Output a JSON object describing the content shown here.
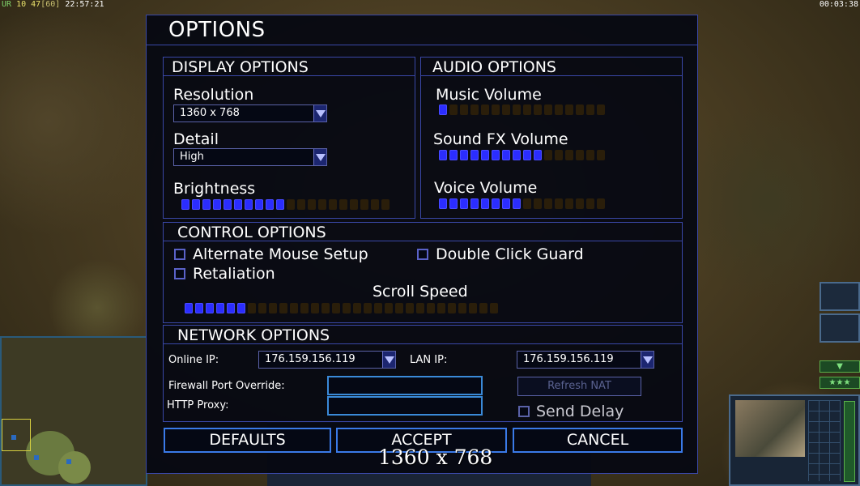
{
  "hud": {
    "rank": "UR",
    "stat_a": "10",
    "stat_b": "47",
    "fps": "[60]",
    "clock": "22:57:21",
    "game_time": "00:03:38"
  },
  "dialog": {
    "title": "OPTIONS",
    "display": {
      "header": "DISPLAY OPTIONS",
      "resolution_label": "Resolution",
      "resolution_value": "1360 x 768",
      "detail_label": "Detail",
      "detail_value": "High",
      "brightness_label": "Brightness",
      "brightness_level": 0.5
    },
    "audio": {
      "header": "AUDIO OPTIONS",
      "music_label": "Music Volume",
      "music_level": 0.0625,
      "sfx_label": "Sound FX Volume",
      "sfx_level": 0.625,
      "voice_label": "Voice Volume",
      "voice_level": 0.5
    },
    "control": {
      "header": "CONTROL OPTIONS",
      "alt_mouse_label": "Alternate Mouse Setup",
      "alt_mouse_checked": false,
      "double_click_label": "Double Click Guard",
      "double_click_checked": false,
      "retaliation_label": "Retaliation",
      "retaliation_checked": false,
      "scroll_label": "Scroll Speed",
      "scroll_level": 0.2
    },
    "network": {
      "header": "NETWORK OPTIONS",
      "online_ip_label": "Online IP:",
      "online_ip_value": "176.159.156.119",
      "lan_ip_label": "LAN IP:",
      "lan_ip_value": "176.159.156.119",
      "firewall_label": "Firewall Port Override:",
      "firewall_value": "",
      "proxy_label": "HTTP Proxy:",
      "proxy_value": "",
      "refresh_nat_label": "Refresh NAT",
      "send_delay_label": "Send Delay",
      "send_delay_checked": false
    },
    "buttons": {
      "defaults": "DEFAULTS",
      "accept": "ACCEPT",
      "cancel": "CANCEL"
    }
  },
  "tooltip_text": "1360 x 768",
  "colors": {
    "slider_on": "#2b2dff",
    "slider_off": "#2a1e0a",
    "border": "#3a48a8",
    "button_border": "#3a7ae8"
  }
}
